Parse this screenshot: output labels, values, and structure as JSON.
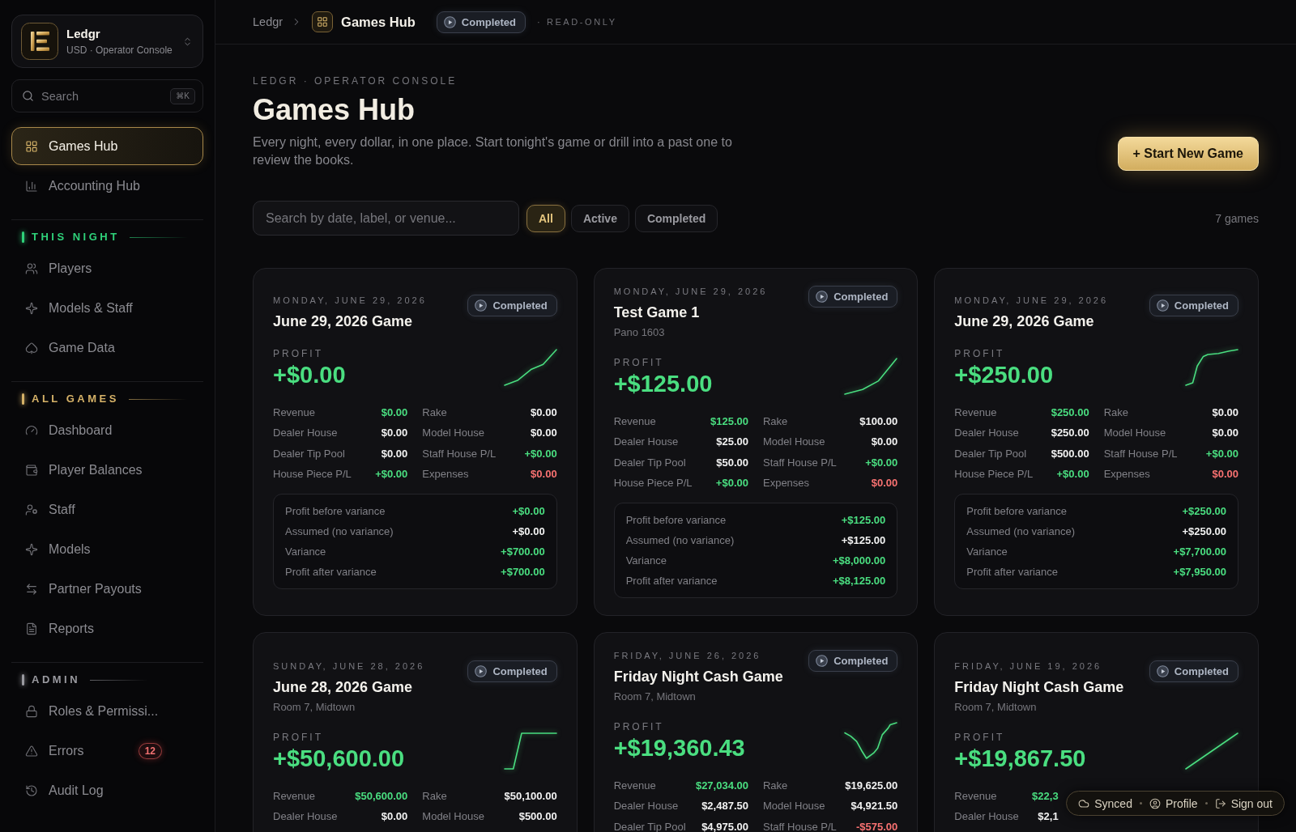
{
  "sidebar": {
    "workspace": {
      "name": "Ledgr",
      "subtitle": "USD · Operator Console"
    },
    "search": {
      "placeholder": "Search",
      "shortcut": "⌘K"
    },
    "nav": [
      {
        "label": "Games Hub",
        "selected": true
      },
      {
        "label": "Accounting Hub",
        "selected": false
      }
    ],
    "sections": [
      {
        "title": "THIS NIGHT",
        "color": "#2fd27a",
        "items": [
          {
            "label": "Players",
            "selected": false
          },
          {
            "label": "Models & Staff",
            "selected": false
          },
          {
            "label": "Game Data",
            "selected": false
          }
        ]
      },
      {
        "title": "ALL GAMES",
        "color": "#d6b268",
        "items": [
          {
            "label": "Dashboard",
            "selected": false
          },
          {
            "label": "Player Balances",
            "selected": false
          },
          {
            "label": "Staff",
            "selected": false
          },
          {
            "label": "Models",
            "selected": false
          },
          {
            "label": "Partner Payouts",
            "selected": false
          },
          {
            "label": "Reports",
            "selected": false
          }
        ]
      },
      {
        "title": "ADMIN",
        "color": "#9a9aa0",
        "items": [
          {
            "label": "Roles & Permissi...",
            "selected": false
          },
          {
            "label": "Errors",
            "selected": false,
            "badge": "12"
          },
          {
            "label": "Audit Log",
            "selected": false
          }
        ]
      }
    ]
  },
  "header": {
    "root": "Ledgr",
    "current": "Games Hub",
    "status": "Completed",
    "mode": "· READ-ONLY"
  },
  "page": {
    "eyebrow": "LEDGR · OPERATOR CONSOLE",
    "title": "Games Hub",
    "description": "Every night, every dollar, in one place. Start tonight's game or drill into a past one to review the books.",
    "primary_action": "+ Start New Game"
  },
  "filters": {
    "search": {
      "placeholder": "Search by date, label, or venue..."
    },
    "tabs": [
      {
        "label": "All",
        "selected": true
      },
      {
        "label": "Active",
        "selected": false
      },
      {
        "label": "Completed",
        "selected": false
      }
    ],
    "count": "7 games"
  },
  "games": [
    {
      "date": "MONDAY, JUNE 29, 2026",
      "title": "June 29, 2026 Game",
      "status": "Completed",
      "profit_label": "PROFIT",
      "profit": "+$0.00",
      "stat_rows": [
        {
          "cells": [
            {
              "label": "Revenue",
              "value": "$0.00",
              "color": "#4ade80"
            },
            {
              "label": "Rake",
              "value": "$0.00",
              "color": "#f2f2f2"
            }
          ]
        },
        {
          "cells": [
            {
              "label": "Dealer House",
              "value": "$0.00",
              "color": "#f2f2f2"
            },
            {
              "label": "Model House",
              "value": "$0.00",
              "color": "#f2f2f2"
            }
          ]
        },
        {
          "cells": [
            {
              "label": "Dealer Tip Pool",
              "value": "$0.00",
              "color": "#f2f2f2"
            },
            {
              "label": "Staff House P/L",
              "value": "+$0.00",
              "color": "#4ade80"
            }
          ]
        },
        {
          "cells": [
            {
              "label": "House Piece P/L",
              "value": "+$0.00",
              "color": "#4ade80"
            },
            {
              "label": "Expenses",
              "value": "$0.00",
              "color": "#f87171"
            }
          ]
        }
      ],
      "breakdown": [
        {
          "label": "Profit before variance",
          "value": "+$0.00",
          "color": "#4ade80"
        },
        {
          "label": "Assumed (no variance)",
          "value": "+$0.00",
          "color": "#f2f2f2"
        },
        {
          "label": "Variance",
          "value": "+$700.00",
          "color": "#4ade80"
        },
        {
          "label": "Profit after variance",
          "value": "+$700.00",
          "color": "#4ade80"
        }
      ]
    },
    {
      "date": "MONDAY, JUNE 29, 2026",
      "title": "Test Game 1",
      "venue": "Pano 1603",
      "status": "Completed",
      "profit_label": "PROFIT",
      "profit": "+$125.00",
      "stat_rows": [
        {
          "cells": [
            {
              "label": "Revenue",
              "value": "$125.00",
              "color": "#4ade80"
            },
            {
              "label": "Rake",
              "value": "$100.00",
              "color": "#f2f2f2"
            }
          ]
        },
        {
          "cells": [
            {
              "label": "Dealer House",
              "value": "$25.00",
              "color": "#f2f2f2"
            },
            {
              "label": "Model House",
              "value": "$0.00",
              "color": "#f2f2f2"
            }
          ]
        },
        {
          "cells": [
            {
              "label": "Dealer Tip Pool",
              "value": "$50.00",
              "color": "#f2f2f2"
            },
            {
              "label": "Staff House P/L",
              "value": "+$0.00",
              "color": "#4ade80"
            }
          ]
        },
        {
          "cells": [
            {
              "label": "House Piece P/L",
              "value": "+$0.00",
              "color": "#4ade80"
            },
            {
              "label": "Expenses",
              "value": "$0.00",
              "color": "#f87171"
            }
          ]
        }
      ],
      "breakdown": [
        {
          "label": "Profit before variance",
          "value": "+$125.00",
          "color": "#4ade80"
        },
        {
          "label": "Assumed (no variance)",
          "value": "+$125.00",
          "color": "#f2f2f2"
        },
        {
          "label": "Variance",
          "value": "+$8,000.00",
          "color": "#4ade80"
        },
        {
          "label": "Profit after variance",
          "value": "+$8,125.00",
          "color": "#4ade80"
        }
      ]
    },
    {
      "date": "MONDAY, JUNE 29, 2026",
      "title": "June 29, 2026 Game",
      "status": "Completed",
      "profit_label": "PROFIT",
      "profit": "+$250.00",
      "stat_rows": [
        {
          "cells": [
            {
              "label": "Revenue",
              "value": "$250.00",
              "color": "#4ade80"
            },
            {
              "label": "Rake",
              "value": "$0.00",
              "color": "#f2f2f2"
            }
          ]
        },
        {
          "cells": [
            {
              "label": "Dealer House",
              "value": "$250.00",
              "color": "#f2f2f2"
            },
            {
              "label": "Model House",
              "value": "$0.00",
              "color": "#f2f2f2"
            }
          ]
        },
        {
          "cells": [
            {
              "label": "Dealer Tip Pool",
              "value": "$500.00",
              "color": "#f2f2f2"
            },
            {
              "label": "Staff House P/L",
              "value": "+$0.00",
              "color": "#4ade80"
            }
          ]
        },
        {
          "cells": [
            {
              "label": "House Piece P/L",
              "value": "+$0.00",
              "color": "#4ade80"
            },
            {
              "label": "Expenses",
              "value": "$0.00",
              "color": "#f87171"
            }
          ]
        }
      ],
      "breakdown": [
        {
          "label": "Profit before variance",
          "value": "+$250.00",
          "color": "#4ade80"
        },
        {
          "label": "Assumed (no variance)",
          "value": "+$250.00",
          "color": "#f2f2f2"
        },
        {
          "label": "Variance",
          "value": "+$7,700.00",
          "color": "#4ade80"
        },
        {
          "label": "Profit after variance",
          "value": "+$7,950.00",
          "color": "#4ade80"
        }
      ]
    },
    {
      "date": "SUNDAY, JUNE 28, 2026",
      "title": "June 28, 2026 Game",
      "venue": "Room 7, Midtown",
      "status": "Completed",
      "profit_label": "PROFIT",
      "profit": "+$50,600.00",
      "stat_rows": [
        {
          "cells": [
            {
              "label": "Revenue",
              "value": "$50,600.00",
              "color": "#4ade80"
            },
            {
              "label": "Rake",
              "value": "$50,100.00",
              "color": "#f2f2f2"
            }
          ]
        },
        {
          "cells": [
            {
              "label": "Dealer House",
              "value": "$0.00",
              "color": "#f2f2f2"
            },
            {
              "label": "Model House",
              "value": "$500.00",
              "color": "#f2f2f2"
            }
          ]
        }
      ]
    },
    {
      "date": "FRIDAY, JUNE 26, 2026",
      "title": "Friday Night Cash Game",
      "venue": "Room 7, Midtown",
      "status": "Completed",
      "profit_label": "PROFIT",
      "profit": "+$19,360.43",
      "stat_rows": [
        {
          "cells": [
            {
              "label": "Revenue",
              "value": "$27,034.00",
              "color": "#4ade80"
            },
            {
              "label": "Rake",
              "value": "$19,625.00",
              "color": "#f2f2f2"
            }
          ]
        },
        {
          "cells": [
            {
              "label": "Dealer House",
              "value": "$2,487.50",
              "color": "#f2f2f2"
            },
            {
              "label": "Model House",
              "value": "$4,921.50",
              "color": "#f2f2f2"
            }
          ]
        },
        {
          "cells": [
            {
              "label": "Dealer Tip Pool",
              "value": "$4,975.00",
              "color": "#f2f2f2"
            },
            {
              "label": "Staff House P/L",
              "value": "-$575.00",
              "color": "#f87171"
            }
          ]
        }
      ]
    },
    {
      "date": "FRIDAY, JUNE 19, 2026",
      "title": "Friday Night Cash Game",
      "venue": "Room 7, Midtown",
      "status": "Completed",
      "profit_label": "PROFIT",
      "profit": "+$19,867.50",
      "stat_rows": [
        {
          "cells": [
            {
              "label": "Revenue",
              "value": "$22,3",
              "color": "#4ade80",
              "covered": true
            }
          ]
        },
        {
          "cells": [
            {
              "label": "Dealer House",
              "value": "$2,1",
              "color": "#f2f2f2",
              "covered": true
            }
          ]
        }
      ]
    }
  ],
  "session_bar": {
    "items": [
      {
        "label": "Synced"
      },
      {
        "label": "Profile"
      },
      {
        "label": "Sign out"
      }
    ]
  }
}
